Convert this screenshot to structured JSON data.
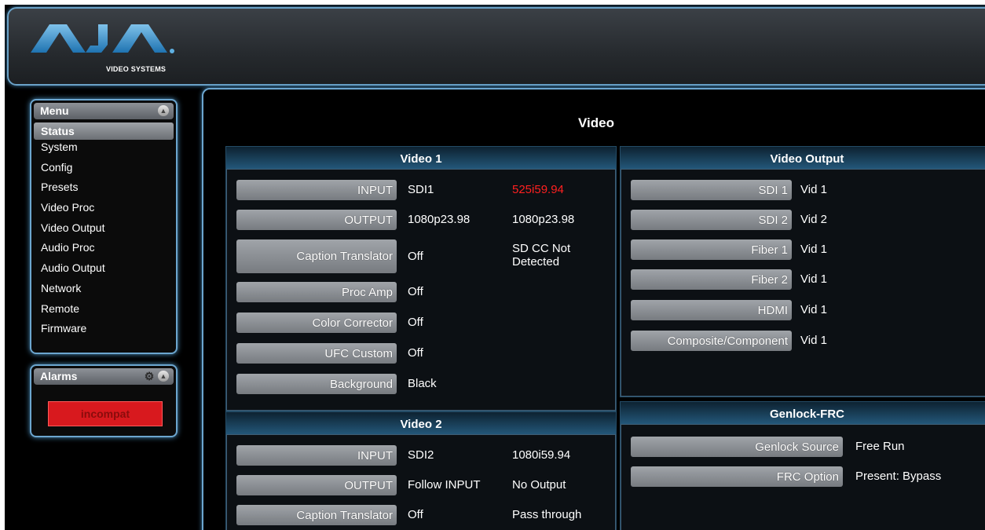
{
  "header": {
    "logo_text": "AJA",
    "logo_subtitle": "VIDEO SYSTEMS"
  },
  "menu": {
    "title": "Menu",
    "items": [
      {
        "label": "Status",
        "active": true
      },
      {
        "label": "System"
      },
      {
        "label": "Config"
      },
      {
        "label": "Presets"
      },
      {
        "label": "Video Proc"
      },
      {
        "label": "Video Output"
      },
      {
        "label": "Audio Proc"
      },
      {
        "label": "Audio Output"
      },
      {
        "label": "Network"
      },
      {
        "label": "Remote"
      },
      {
        "label": "Firmware"
      }
    ]
  },
  "alarms": {
    "title": "Alarms",
    "alarm_label": "incompat"
  },
  "page": {
    "title": "Video"
  },
  "video1": {
    "title": "Video 1",
    "rows": [
      {
        "label": "INPUT",
        "value": "SDI1",
        "status": "525i59.94"
      },
      {
        "label": "OUTPUT",
        "value": "1080p23.98",
        "status": "1080p23.98"
      },
      {
        "label": "Caption Translator",
        "value": "Off",
        "status": "SD CC Not Detected"
      },
      {
        "label": "Proc Amp",
        "value": "Off"
      },
      {
        "label": "Color Corrector",
        "value": "Off"
      },
      {
        "label": "UFC Custom",
        "value": "Off"
      },
      {
        "label": "Background",
        "value": "Black"
      }
    ]
  },
  "video2": {
    "title": "Video 2",
    "rows": [
      {
        "label": "INPUT",
        "value": "SDI2",
        "status": "1080i59.94"
      },
      {
        "label": "OUTPUT",
        "value": "Follow INPUT",
        "status": "No Output"
      },
      {
        "label": "Caption Translator",
        "value": "Off",
        "status": "Pass through"
      }
    ]
  },
  "video_output": {
    "title": "Video Output",
    "rows": [
      {
        "label": "SDI 1",
        "value": "Vid 1"
      },
      {
        "label": "SDI 2",
        "value": "Vid 2"
      },
      {
        "label": "Fiber 1",
        "value": "Vid 1"
      },
      {
        "label": "Fiber 2",
        "value": "Vid 1"
      },
      {
        "label": "HDMI",
        "value": "Vid 1"
      },
      {
        "label": "Composite/Component",
        "value": "Vid 1"
      }
    ]
  },
  "genlock": {
    "title": "Genlock-FRC",
    "rows": [
      {
        "label": "Genlock Source",
        "value": "Free Run"
      },
      {
        "label": "FRC Option",
        "value": "Present: Bypass"
      }
    ]
  },
  "colors": {
    "accent_border": "#6ca6cf",
    "alarm_red": "#d8191e",
    "status_red": "#ff2020"
  }
}
